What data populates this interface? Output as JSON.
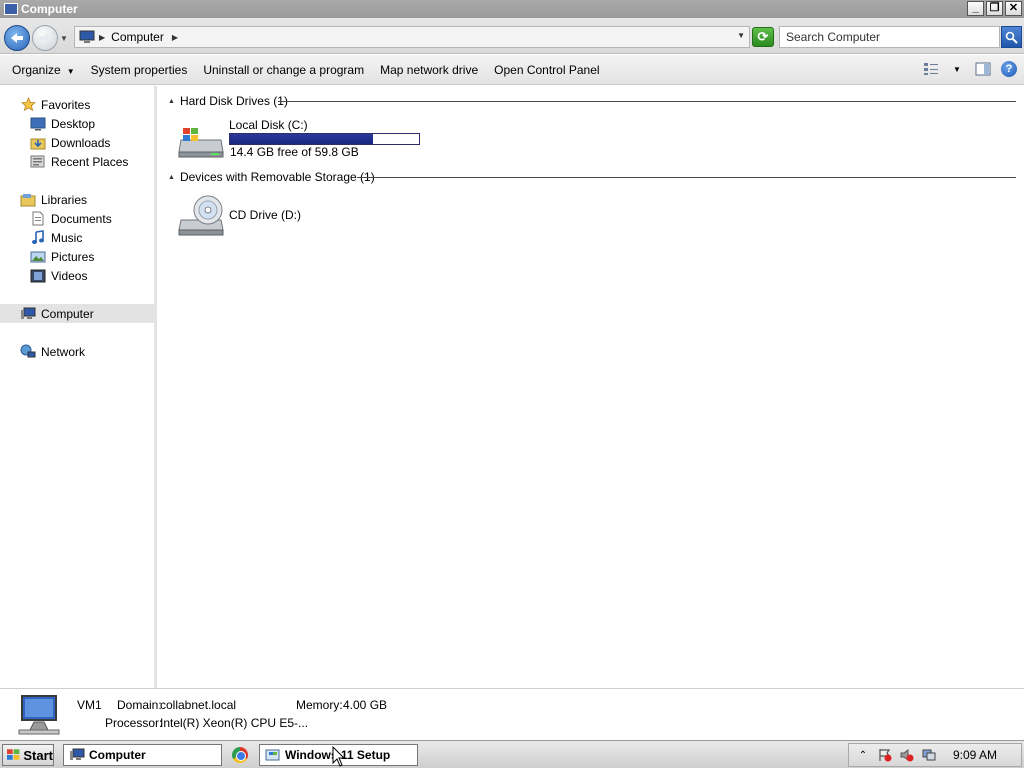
{
  "window": {
    "title": "Computer",
    "buttons": {
      "minimize": "_",
      "restore": "❐",
      "close": "✕"
    }
  },
  "address": {
    "breadcrumb": "Computer",
    "search_placeholder": "Search Computer"
  },
  "toolbar": {
    "organize": "Organize",
    "system_properties": "System properties",
    "uninstall": "Uninstall or change a program",
    "map_drive": "Map network drive",
    "control_panel": "Open Control Panel"
  },
  "nav": {
    "favorites": "Favorites",
    "desktop": "Desktop",
    "downloads": "Downloads",
    "recent_places": "Recent Places",
    "libraries": "Libraries",
    "documents": "Documents",
    "music": "Music",
    "pictures": "Pictures",
    "videos": "Videos",
    "computer": "Computer",
    "network": "Network"
  },
  "groups": {
    "hard_disks": "Hard Disk Drives (1)",
    "removable": "Devices with Removable Storage (1)"
  },
  "drives": {
    "c": {
      "label": "Local Disk (C:)",
      "free_text": "14.4 GB free of 59.8 GB",
      "used_fraction": 0.759
    },
    "d": {
      "label": "CD Drive (D:)"
    }
  },
  "details": {
    "name": "VM1",
    "domain_label": "Domain:",
    "domain_value": "collabnet.local",
    "memory_label": "Memory:",
    "memory_value": "4.00 GB",
    "processor_label": "Processor:",
    "processor_value": "Intel(R) Xeon(R) CPU E5-..."
  },
  "taskbar": {
    "start": "Start",
    "task_computer": "Computer",
    "task_setup": "Windows 11 Setup",
    "clock": "9:09 AM"
  },
  "colors": {
    "selected_nav": "#e3e3e3",
    "progress_fill": "#1a2780",
    "accent_blue": "#2a66b9"
  }
}
